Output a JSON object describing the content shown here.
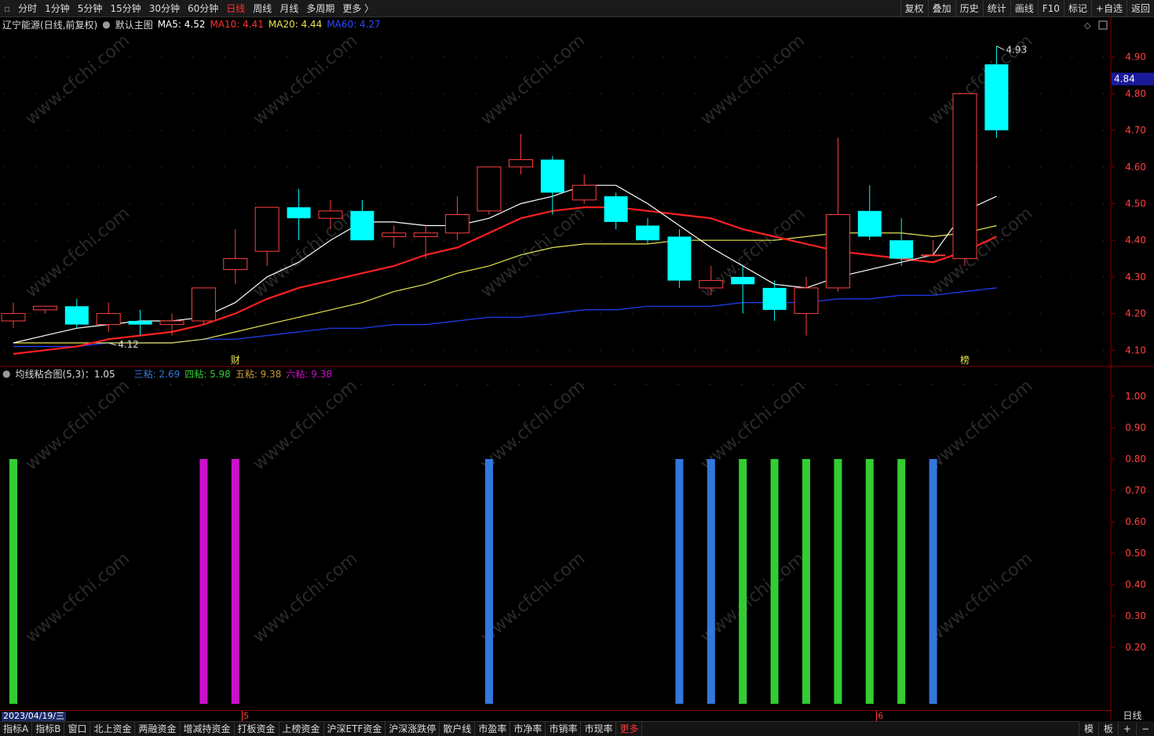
{
  "toolbar": {
    "periods": [
      "分时",
      "1分钟",
      "5分钟",
      "15分钟",
      "30分钟",
      "60分钟",
      "日线",
      "周线",
      "月线",
      "多周期",
      "更多 〉"
    ],
    "active_period": "日线",
    "right_buttons": [
      "复权",
      "叠加",
      "历史",
      "统计",
      "画线",
      "F10",
      "标记",
      "+自选",
      "返回"
    ]
  },
  "main_info": {
    "stock_name": "辽宁能源",
    "adjust": "(日线,前复权)",
    "template": "默认主图",
    "ma5": "MA5: 4.52",
    "ma10": "MA10: 4.41",
    "ma20": "MA20: 4.44",
    "ma60": "MA60: 4.27"
  },
  "sub_info": {
    "name": "均线粘合图(5,3)：1.05",
    "san": "三粘: 2.69",
    "si": "四粘: 5.98",
    "wu": "五粘: 9.38",
    "liu": "六粘: 9.38"
  },
  "colors": {
    "up": "#ff4040",
    "down": "#00ffff",
    "ma5": "#ffffff",
    "ma10": "#ff2020",
    "ma20": "#e6e650",
    "ma60": "#2040ff",
    "green_bar": "#33cc33",
    "magenta_bar": "#cc11cc",
    "blue_bar": "#3377dd"
  },
  "chart_data": [
    {
      "type": "candlestick",
      "title": "辽宁能源 日线",
      "y_ticks": [
        "4.90",
        "4.80",
        "4.70",
        "4.60",
        "4.50",
        "4.40",
        "4.30",
        "4.20",
        "4.10"
      ],
      "ylim": [
        4.06,
        4.97
      ],
      "current_price": "4.84",
      "high_label": "4.93",
      "low_label": "4.12",
      "candles": [
        {
          "o": 4.18,
          "c": 4.2,
          "h": 4.23,
          "l": 4.16
        },
        {
          "o": 4.21,
          "c": 4.22,
          "h": 4.22,
          "l": 4.2
        },
        {
          "o": 4.22,
          "c": 4.17,
          "h": 4.24,
          "l": 4.16
        },
        {
          "o": 4.17,
          "c": 4.2,
          "h": 4.23,
          "l": 4.15
        },
        {
          "o": 4.18,
          "c": 4.17,
          "h": 4.21,
          "l": 4.14
        },
        {
          "o": 4.17,
          "c": 4.18,
          "h": 4.2,
          "l": 4.14
        },
        {
          "o": 4.18,
          "c": 4.27,
          "h": 4.27,
          "l": 4.17
        },
        {
          "o": 4.32,
          "c": 4.35,
          "h": 4.43,
          "l": 4.28
        },
        {
          "o": 4.37,
          "c": 4.49,
          "h": 4.49,
          "l": 4.33
        },
        {
          "o": 4.49,
          "c": 4.46,
          "h": 4.54,
          "l": 4.4
        },
        {
          "o": 4.46,
          "c": 4.48,
          "h": 4.51,
          "l": 4.43
        },
        {
          "o": 4.48,
          "c": 4.4,
          "h": 4.51,
          "l": 4.4
        },
        {
          "o": 4.41,
          "c": 4.42,
          "h": 4.44,
          "l": 4.38
        },
        {
          "o": 4.41,
          "c": 4.42,
          "h": 4.44,
          "l": 4.35
        },
        {
          "o": 4.42,
          "c": 4.47,
          "h": 4.52,
          "l": 4.4
        },
        {
          "o": 4.48,
          "c": 4.6,
          "h": 4.6,
          "l": 4.47
        },
        {
          "o": 4.6,
          "c": 4.62,
          "h": 4.69,
          "l": 4.58
        },
        {
          "o": 4.62,
          "c": 4.53,
          "h": 4.63,
          "l": 4.47
        },
        {
          "o": 4.51,
          "c": 4.55,
          "h": 4.58,
          "l": 4.5
        },
        {
          "o": 4.52,
          "c": 4.45,
          "h": 4.53,
          "l": 4.43
        },
        {
          "o": 4.44,
          "c": 4.4,
          "h": 4.46,
          "l": 4.39
        },
        {
          "o": 4.41,
          "c": 4.29,
          "h": 4.43,
          "l": 4.27
        },
        {
          "o": 4.27,
          "c": 4.29,
          "h": 4.33,
          "l": 4.25
        },
        {
          "o": 4.3,
          "c": 4.28,
          "h": 4.33,
          "l": 4.2
        },
        {
          "o": 4.27,
          "c": 4.21,
          "h": 4.29,
          "l": 4.18
        },
        {
          "o": 4.2,
          "c": 4.27,
          "h": 4.3,
          "l": 4.14
        },
        {
          "o": 4.27,
          "c": 4.47,
          "h": 4.68,
          "l": 4.26
        },
        {
          "o": 4.48,
          "c": 4.41,
          "h": 4.55,
          "l": 4.4
        },
        {
          "o": 4.4,
          "c": 4.35,
          "h": 4.46,
          "l": 4.33
        },
        {
          "o": 4.36,
          "c": 4.36,
          "h": 4.4,
          "l": 4.36
        },
        {
          "o": 4.35,
          "c": 4.8,
          "h": 4.8,
          "l": 4.33
        },
        {
          "o": 4.88,
          "c": 4.7,
          "h": 4.93,
          "l": 4.68
        }
      ],
      "ma5": [
        4.12,
        4.14,
        4.16,
        4.17,
        4.18,
        4.18,
        4.19,
        4.23,
        4.3,
        4.34,
        4.4,
        4.45,
        4.45,
        4.44,
        4.44,
        4.46,
        4.5,
        4.52,
        4.55,
        4.55,
        4.5,
        4.44,
        4.38,
        4.33,
        4.28,
        4.27,
        4.3,
        4.32,
        4.34,
        4.36,
        4.48,
        4.52
      ],
      "ma10": [
        4.09,
        4.1,
        4.11,
        4.13,
        4.14,
        4.15,
        4.17,
        4.2,
        4.24,
        4.27,
        4.29,
        4.31,
        4.33,
        4.36,
        4.38,
        4.42,
        4.46,
        4.48,
        4.49,
        4.49,
        4.48,
        4.47,
        4.46,
        4.43,
        4.41,
        4.39,
        4.37,
        4.36,
        4.35,
        4.34,
        4.37,
        4.41
      ],
      "ma20": [
        4.12,
        4.12,
        4.12,
        4.12,
        4.12,
        4.12,
        4.13,
        4.15,
        4.17,
        4.19,
        4.21,
        4.23,
        4.26,
        4.28,
        4.31,
        4.33,
        4.36,
        4.38,
        4.39,
        4.39,
        4.39,
        4.4,
        4.4,
        4.4,
        4.4,
        4.41,
        4.42,
        4.42,
        4.42,
        4.41,
        4.42,
        4.44
      ],
      "ma60": [
        4.11,
        4.11,
        4.11,
        4.12,
        4.12,
        4.12,
        4.13,
        4.13,
        4.14,
        4.15,
        4.16,
        4.16,
        4.17,
        4.17,
        4.18,
        4.19,
        4.19,
        4.2,
        4.21,
        4.21,
        4.22,
        4.22,
        4.22,
        4.23,
        4.23,
        4.23,
        4.24,
        4.24,
        4.25,
        4.25,
        4.26,
        4.27
      ],
      "markers": [
        {
          "index": 7,
          "label": "财"
        },
        {
          "index": 30,
          "label": "榜"
        }
      ]
    },
    {
      "type": "bar",
      "title": "均线粘合图(5,3)",
      "y_ticks": [
        "1.00",
        "0.90",
        "0.80",
        "0.70",
        "0.60",
        "0.50",
        "0.40",
        "0.30",
        "0.20"
      ],
      "ylim": [
        0.0,
        1.05
      ],
      "bars": [
        {
          "index": 0,
          "value": 0.8,
          "color": "green"
        },
        {
          "index": 6,
          "value": 0.8,
          "color": "magenta"
        },
        {
          "index": 7,
          "value": 0.8,
          "color": "magenta"
        },
        {
          "index": 15,
          "value": 0.8,
          "color": "blue"
        },
        {
          "index": 21,
          "value": 0.8,
          "color": "blue"
        },
        {
          "index": 22,
          "value": 0.8,
          "color": "blue"
        },
        {
          "index": 23,
          "value": 0.8,
          "color": "green"
        },
        {
          "index": 24,
          "value": 0.8,
          "color": "green"
        },
        {
          "index": 25,
          "value": 0.8,
          "color": "green"
        },
        {
          "index": 26,
          "value": 0.8,
          "color": "green"
        },
        {
          "index": 27,
          "value": 0.8,
          "color": "green"
        },
        {
          "index": 28,
          "value": 0.8,
          "color": "green"
        },
        {
          "index": 29,
          "value": 0.8,
          "color": "blue"
        }
      ]
    }
  ],
  "date_bar": {
    "start_date": "2023/04/19/三",
    "month_labels": [
      {
        "index": 8,
        "label": "5"
      },
      {
        "index": 28,
        "label": "6"
      }
    ],
    "period_label": "日线"
  },
  "bottom_tabs": [
    "指标A",
    "指标B",
    "窗口",
    "北上资金",
    "两融资金",
    "增减持资金",
    "打板资金",
    "上榜资金",
    "沪深ETF资金",
    "沪深涨跌停",
    "散户线",
    "市盈率",
    "市净率",
    "市销率",
    "市现率",
    "更多"
  ],
  "bottom_right": [
    "模",
    "板",
    "+",
    "−"
  ],
  "watermark": "www.cfchi.com"
}
